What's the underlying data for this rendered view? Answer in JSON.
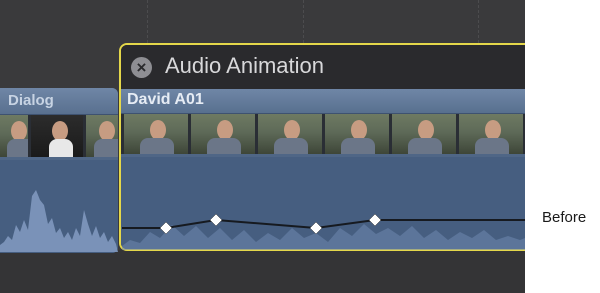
{
  "timeline": {
    "left_clip": {
      "title": "Dialog"
    },
    "animation": {
      "title": "Audio Animation",
      "close_glyph": "×"
    },
    "main_clip": {
      "title": "David A01"
    },
    "callout": {
      "label": "Before"
    }
  },
  "colors": {
    "selection": "#e4d74a",
    "clip_header": "#6f86a6",
    "clip_body": "#4f6686",
    "waveform": "#7f98be",
    "keyframe": "#ffffff"
  },
  "icons": {
    "close": "close-icon",
    "keyframe": "diamond-icon"
  }
}
